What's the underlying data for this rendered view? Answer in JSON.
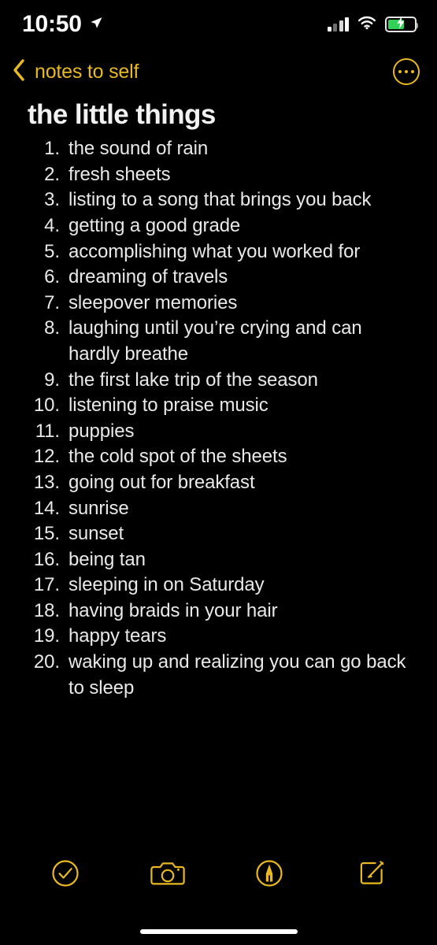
{
  "status_bar": {
    "time": "10:50",
    "location_icon": "location-arrow-icon",
    "signal_icon": "cellular-signal-icon",
    "wifi_icon": "wifi-icon",
    "battery_icon": "battery-charging-icon",
    "battery_level_percent": 62,
    "battery_charging": true,
    "battery_color": "#31d158"
  },
  "nav_bar": {
    "back_icon": "chevron-left-icon",
    "back_label": "notes to self",
    "more_icon": "more-ellipsis-circle-icon",
    "accent_color": "#e8b923"
  },
  "note": {
    "title": "the little things",
    "items": [
      {
        "number": "1.",
        "text": "the sound of rain"
      },
      {
        "number": "2.",
        "text": "fresh sheets"
      },
      {
        "number": "3.",
        "text": "listing to a song that brings you back"
      },
      {
        "number": "4.",
        "text": "getting a good grade"
      },
      {
        "number": "5.",
        "text": "accomplishing what you worked for"
      },
      {
        "number": "6.",
        "text": "dreaming of travels"
      },
      {
        "number": "7.",
        "text": "sleepover memories"
      },
      {
        "number": "8.",
        "text": "laughing until you’re crying and can hardly breathe"
      },
      {
        "number": "9.",
        "text": "the first lake trip of the season"
      },
      {
        "number": "10.",
        "text": "listening to praise music"
      },
      {
        "number": "11.",
        "text": "puppies"
      },
      {
        "number": "12.",
        "text": "the cold spot of the sheets"
      },
      {
        "number": "13.",
        "text": "going out for breakfast"
      },
      {
        "number": "14.",
        "text": "sunrise"
      },
      {
        "number": "15.",
        "text": "sunset"
      },
      {
        "number": "16.",
        "text": "being tan"
      },
      {
        "number": "17.",
        "text": "sleeping in on Saturday"
      },
      {
        "number": "18.",
        "text": "having braids in your hair"
      },
      {
        "number": "19.",
        "text": "happy tears"
      },
      {
        "number": "20.",
        "text": "waking up and realizing you can go back to sleep"
      }
    ]
  },
  "toolbar": {
    "accent_color": "#e8b923",
    "buttons": [
      {
        "icon": "checklist-circle-icon"
      },
      {
        "icon": "camera-icon"
      },
      {
        "icon": "markup-pen-circle-icon"
      },
      {
        "icon": "compose-note-icon"
      }
    ]
  },
  "home_indicator": {
    "icon": "home-indicator-bar"
  }
}
